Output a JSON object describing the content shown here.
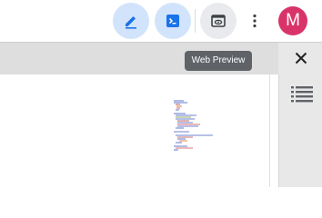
{
  "toolbar": {
    "edit_icon": "pencil-icon",
    "terminal_icon": "terminal-icon",
    "preview_icon": "web-preview-icon",
    "more_icon": "more-vert-icon",
    "avatar_letter": "M",
    "avatar_color": "#d9346a",
    "accent_color": "#1a73e8"
  },
  "tooltip": {
    "text": "Web Preview"
  },
  "panel": {
    "close_icon": "close-icon",
    "outline_icon": "list-icon"
  }
}
